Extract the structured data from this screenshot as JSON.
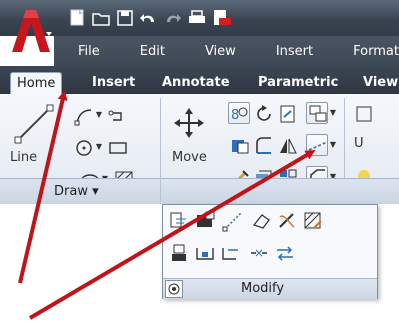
{
  "menubar": {
    "items": [
      "File",
      "Edit",
      "View",
      "Insert",
      "Format"
    ]
  },
  "tabs": [
    {
      "label": "Home",
      "active": true
    },
    {
      "label": "Insert"
    },
    {
      "label": "Annotate"
    },
    {
      "label": "Parametric"
    },
    {
      "label": "View"
    }
  ],
  "ribbon": {
    "line_label": "Line",
    "move_label": "Move",
    "draw_panel": "Draw ▾",
    "modify_panel": "Modify",
    "partial_right": "U"
  },
  "colors": {
    "arrow": "#c0141a",
    "titlebar": "#3a4552",
    "ribbon": "#e8edf4"
  },
  "icons": [
    "app-menu-icon",
    "new-icon",
    "open-icon",
    "save-icon",
    "undo-icon",
    "redo-icon",
    "print-icon",
    "publish-pdf-icon"
  ]
}
